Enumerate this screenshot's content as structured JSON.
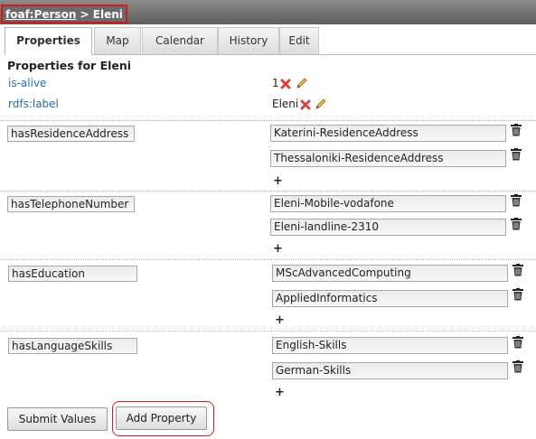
{
  "header": {
    "class_link": "foaf:Person",
    "separator": " > ",
    "resource_name": "Eleni"
  },
  "tabs": [
    {
      "label": "Properties",
      "active": true
    },
    {
      "label": "Map",
      "active": false
    },
    {
      "label": "Calendar",
      "active": false
    },
    {
      "label": "History",
      "active": false
    },
    {
      "label": "Edit",
      "active": false
    }
  ],
  "panel": {
    "title": "Properties for Eleni",
    "literals": [
      {
        "name": "is-alive",
        "value": "1"
      },
      {
        "name": "rdfs:label",
        "value": "Eleni"
      }
    ],
    "groups": [
      {
        "property": "hasResidenceAddress",
        "values": [
          "Katerini-ResidenceAddress",
          "Thessaloniki-ResidenceAddress"
        ]
      },
      {
        "property": "hasTelephoneNumber",
        "values": [
          "Eleni-Mobile-vodafone",
          "Eleni-landline-2310"
        ]
      },
      {
        "property": "hasEducation",
        "values": [
          "MScAdvancedComputing",
          "AppliedInformatics"
        ]
      },
      {
        "property": "hasLanguageSkills",
        "values": [
          "English-Skills",
          "German-Skills"
        ]
      }
    ],
    "add_value_symbol": "+"
  },
  "buttons": {
    "submit_label": "Submit Values",
    "add_property_label": "Add Property"
  },
  "colors": {
    "highlight": "#d11b1b",
    "link": "#2a6ea8",
    "titlebar": "#6a6a6a"
  },
  "icons": {
    "delete_literal": "red-x-icon",
    "edit_literal": "pencil-icon",
    "delete_value": "trash-icon"
  }
}
